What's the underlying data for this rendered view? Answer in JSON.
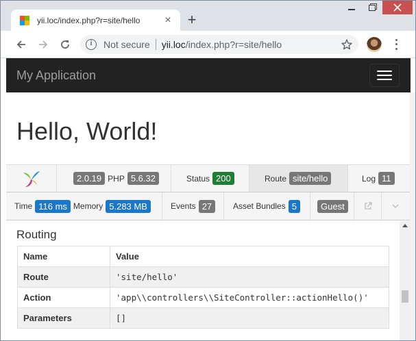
{
  "browser": {
    "tab_title": "yii.loc/index.php?r=site/hello",
    "security_label": "Not secure",
    "url_host": "yii.loc",
    "url_path": "/index.php?r=site/hello"
  },
  "app": {
    "brand": "My Application",
    "heading": "Hello, World!"
  },
  "debug_toolbar": {
    "yii_version": "2.0.19",
    "php_label": "PHP",
    "php_version": "5.6.32",
    "status_label": "Status",
    "status_value": "200",
    "route_label": "Route",
    "route_value": "site/hello",
    "log_label": "Log",
    "log_value": "11",
    "time_label": "Time",
    "time_value": "116 ms",
    "memory_label": "Memory",
    "memory_value": "5.283 MB",
    "events_label": "Events",
    "events_value": "27",
    "assets_label": "Asset Bundles",
    "assets_value": "5",
    "user_value": "Guest"
  },
  "panel": {
    "title": "Routing",
    "columns": [
      "Name",
      "Value"
    ],
    "rows": [
      {
        "name": "Route",
        "value": "'site/hello'"
      },
      {
        "name": "Action",
        "value": "'app\\\\controllers\\\\SiteController::actionHello()'"
      },
      {
        "name": "Parameters",
        "value": "[]"
      }
    ]
  },
  "colors": {
    "navbar": "#222222",
    "status_ok": "#1e7e34",
    "label_gray": "#777777",
    "label_blue": "#1a77c9"
  }
}
